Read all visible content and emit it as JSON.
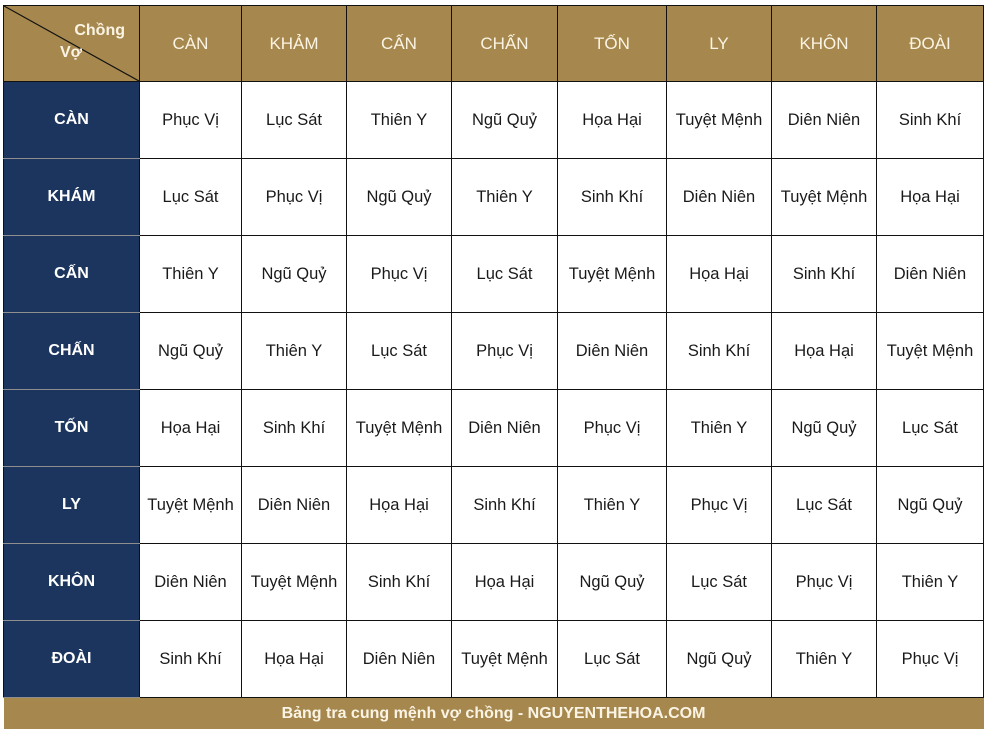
{
  "corner": {
    "husband_label": "Chồng",
    "wife_label": "Vợ"
  },
  "columns": [
    "CÀN",
    "KHẢM",
    "CẤN",
    "CHẤN",
    "TỐN",
    "LY",
    "KHÔN",
    "ĐOÀI"
  ],
  "rows": [
    {
      "label": "CÀN",
      "cells": [
        "Phục Vị",
        "Lục Sát",
        "Thiên Y",
        "Ngũ Quỷ",
        "Họa Hại",
        "Tuyệt Mệnh",
        "Diên Niên",
        "Sinh Khí"
      ]
    },
    {
      "label": "KHÁM",
      "cells": [
        "Lục Sát",
        "Phục Vị",
        "Ngũ Quỷ",
        "Thiên Y",
        "Sinh Khí",
        "Diên Niên",
        "Tuyệt Mệnh",
        "Họa Hại"
      ]
    },
    {
      "label": "CẤN",
      "cells": [
        "Thiên Y",
        "Ngũ Quỷ",
        "Phục Vị",
        "Lục Sát",
        "Tuyệt Mệnh",
        "Họa Hại",
        "Sinh Khí",
        "Diên Niên"
      ]
    },
    {
      "label": "CHẤN",
      "cells": [
        "Ngũ Quỷ",
        "Thiên Y",
        "Lục Sát",
        "Phục Vị",
        "Diên Niên",
        "Sinh Khí",
        "Họa Hại",
        "Tuyệt Mệnh"
      ]
    },
    {
      "label": "TỐN",
      "cells": [
        "Họa Hại",
        "Sinh Khí",
        "Tuyệt Mệnh",
        "Diên Niên",
        "Phục Vị",
        "Thiên Y",
        "Ngũ Quỷ",
        "Lục Sát"
      ]
    },
    {
      "label": "LY",
      "cells": [
        "Tuyệt Mệnh",
        "Diên Niên",
        "Họa Hại",
        "Sinh Khí",
        "Thiên Y",
        "Phục Vị",
        "Lục Sát",
        "Ngũ Quỷ"
      ]
    },
    {
      "label": "KHÔN",
      "cells": [
        "Diên Niên",
        "Tuyệt Mệnh",
        "Sinh Khí",
        "Họa Hại",
        "Ngũ Quỷ",
        "Lục Sát",
        "Phục Vị",
        "Thiên Y"
      ]
    },
    {
      "label": "ĐOÀI",
      "cells": [
        "Sinh Khí",
        "Họa Hại",
        "Diên Niên",
        "Tuyệt Mệnh",
        "Lục Sát",
        "Ngũ Quỷ",
        "Thiên Y",
        "Phục Vị"
      ]
    }
  ],
  "footer": "Bảng tra cung mệnh vợ chồng - NGUYENTHEHOA.COM",
  "colors": {
    "header_gold": "#a6884f",
    "row_header_navy": "#1c355e",
    "cell_bg": "#ffffff"
  }
}
